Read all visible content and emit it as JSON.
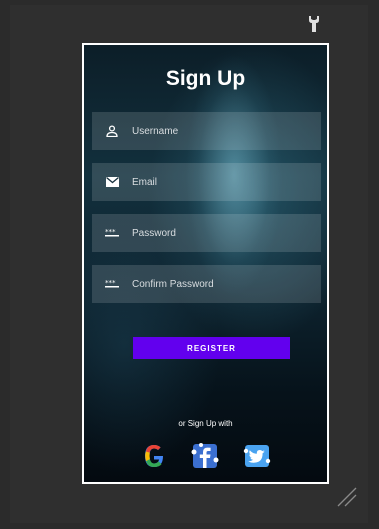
{
  "window": {
    "icons": {
      "tool": "wrench-icon",
      "resize": "resize-grip-icon"
    }
  },
  "signup": {
    "title": "Sign Up",
    "fields": [
      {
        "placeholder": "Username",
        "icon": "person-icon"
      },
      {
        "placeholder": "Email",
        "icon": "mail-icon"
      },
      {
        "placeholder": "Password",
        "icon": "password-icon"
      },
      {
        "placeholder": "Confirm Password",
        "icon": "password-icon"
      }
    ],
    "register_label": "REGISTER",
    "or_text": "or Sign Up with",
    "social": [
      {
        "name": "google",
        "icon": "google-icon"
      },
      {
        "name": "facebook",
        "icon": "facebook-icon"
      },
      {
        "name": "twitter",
        "icon": "twitter-icon"
      }
    ]
  },
  "colors": {
    "accent": "#6200ee",
    "background": "#2b2b2b",
    "frame_border": "#ffffff",
    "google_blue": "#4285f4",
    "google_red": "#ea4335",
    "google_yellow": "#fbbc05",
    "google_green": "#34a853",
    "facebook": "#3b6fd0",
    "twitter": "#4aa3f0"
  }
}
